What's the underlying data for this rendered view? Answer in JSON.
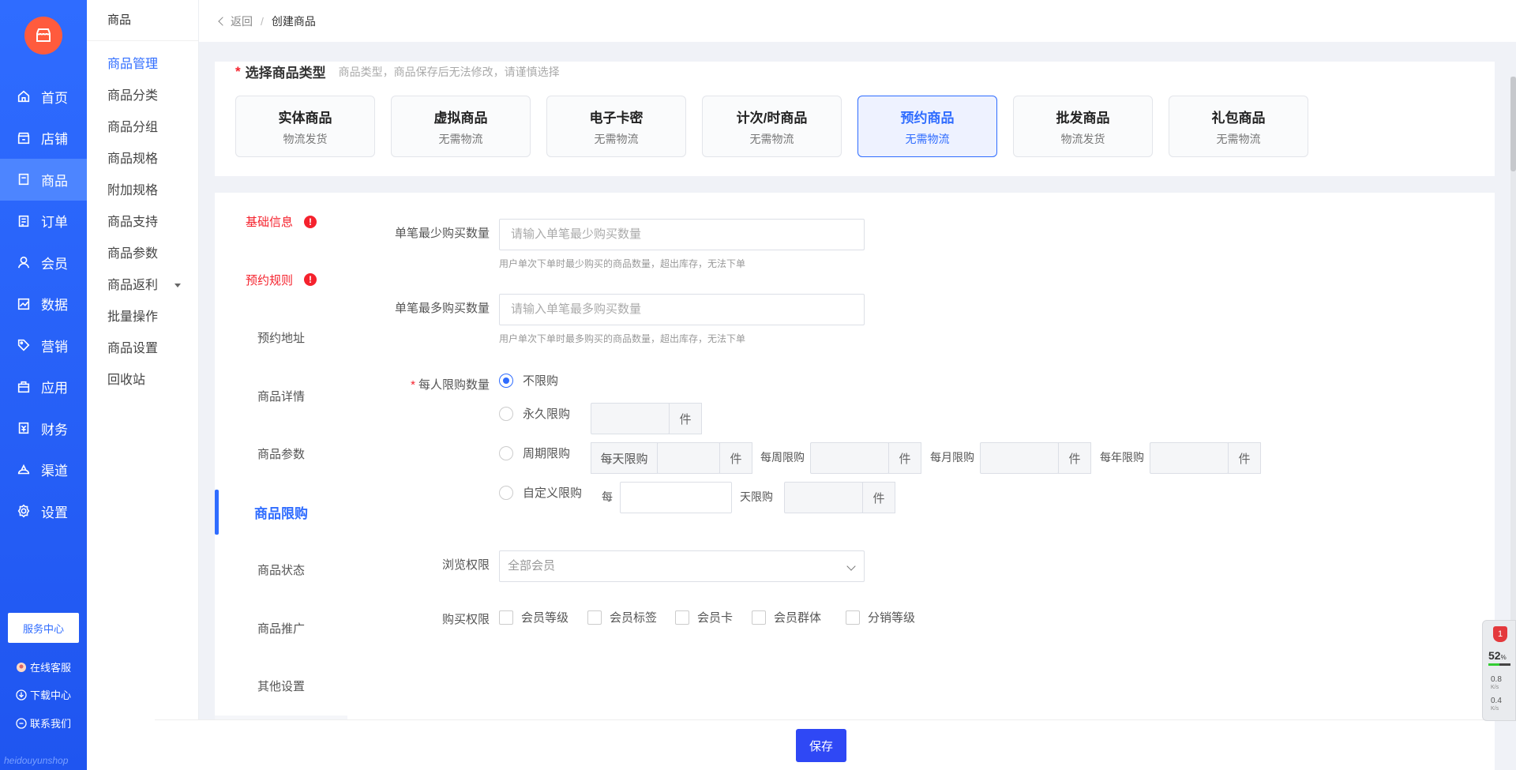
{
  "app": {
    "watermark": "heidouyunshop"
  },
  "left_nav": {
    "items": [
      {
        "label": "首页",
        "icon": "home-icon"
      },
      {
        "label": "店铺",
        "icon": "shop-icon"
      },
      {
        "label": "商品",
        "icon": "product-icon",
        "active": true
      },
      {
        "label": "订单",
        "icon": "order-icon"
      },
      {
        "label": "会员",
        "icon": "user-icon"
      },
      {
        "label": "数据",
        "icon": "chart-icon"
      },
      {
        "label": "营销",
        "icon": "tag-icon"
      },
      {
        "label": "应用",
        "icon": "app-icon"
      },
      {
        "label": "财务",
        "icon": "finance-icon"
      },
      {
        "label": "渠道",
        "icon": "channel-icon"
      },
      {
        "label": "设置",
        "icon": "gear-icon"
      }
    ],
    "service_center": "服务中心",
    "online_service": "在线客服",
    "download_center": "下载中心",
    "contact_us": "联系我们"
  },
  "sub_nav": {
    "title": "商品",
    "items": [
      "商品管理",
      "商品分类",
      "商品分组",
      "商品规格",
      "附加规格",
      "商品支持",
      "商品参数",
      "商品返利",
      "批量操作",
      "商品设置",
      "回收站"
    ]
  },
  "topbar": {
    "back": "返回",
    "separator": "/",
    "crumb": "创建商品"
  },
  "type_section": {
    "star": "*",
    "title": "选择商品类型",
    "hint": "商品类型，商品保存后无法修改，请谨慎选择",
    "types": [
      {
        "name": "实体商品",
        "desc": "物流发货"
      },
      {
        "name": "虚拟商品",
        "desc": "无需物流"
      },
      {
        "name": "电子卡密",
        "desc": "无需物流"
      },
      {
        "name": "计次/时商品",
        "desc": "无需物流"
      },
      {
        "name": "预约商品",
        "desc": "无需物流",
        "active": true
      },
      {
        "name": "批发商品",
        "desc": "物流发货"
      },
      {
        "name": "礼包商品",
        "desc": "无需物流"
      }
    ]
  },
  "tabs": {
    "items": [
      "基础信息",
      "预约规则",
      "预约地址",
      "商品详情",
      "商品参数",
      "商品限购",
      "商品状态",
      "商品推广",
      "其他设置"
    ],
    "error_mark": "!"
  },
  "form": {
    "min_qty": {
      "label": "单笔最少购买数量",
      "placeholder": "请输入单笔最少购买数量",
      "help": "用户单次下单时最少购买的商品数量，超出库存，无法下单"
    },
    "max_qty": {
      "label": "单笔最多购买数量",
      "placeholder": "请输入单笔最多购买数量",
      "help": "用户单次下单时最多购买的商品数量，超出库存，无法下单"
    },
    "limit": {
      "req": "*",
      "label": "每人限购数量",
      "opt_none": "不限购",
      "opt_forever": "永久限购",
      "opt_period": "周期限购",
      "opt_custom": "自定义限购",
      "unit": "件",
      "daily": "每天限购",
      "weekly": "每周限购",
      "monthly": "每月限购",
      "yearly": "每年限购",
      "every": "每",
      "days_limit": "天限购"
    },
    "browse": {
      "label": "浏览权限",
      "value": "全部会员"
    },
    "purchase": {
      "label": "购买权限",
      "options": [
        "会员等级",
        "会员标签",
        "会员卡",
        "会员群体",
        "分销等级"
      ]
    }
  },
  "footer": {
    "save": "保存"
  },
  "monitor": {
    "badge": "1",
    "cpu": "52",
    "cpu_unit": "%",
    "up": "0.8",
    "down": "0.4",
    "speed_unit": "K/s"
  }
}
